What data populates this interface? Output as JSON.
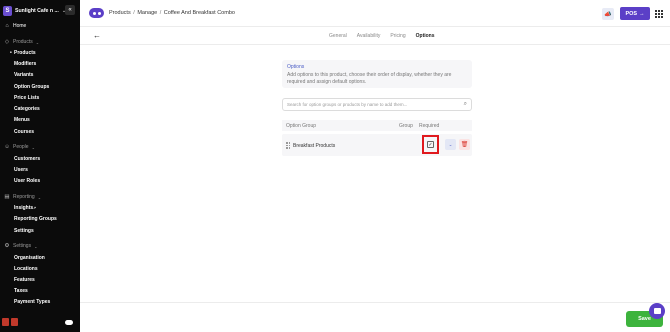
{
  "sidebar": {
    "brand_initial": "S",
    "brand_name": "Sunlight Cafe n ...",
    "collapse_icon": "«",
    "home": "Home",
    "products_section": "Products",
    "products_items": [
      "Products",
      "Modifiers",
      "Variants",
      "Option Groups",
      "Price Lists",
      "Categories",
      "Menus",
      "Courses"
    ],
    "people_section": "People",
    "people_items": [
      "Customers",
      "Users",
      "User Roles"
    ],
    "reporting_section": "Reporting",
    "reporting_items": [
      "Insights",
      "Reporting Groups",
      "Settings"
    ],
    "settings_section": "Settings",
    "settings_items": [
      "Organisation",
      "Locations",
      "Features",
      "Taxes",
      "Payment Types"
    ]
  },
  "topbar": {
    "breadcrumb": [
      "Products",
      "Manage",
      "Coffee And Breakfast Combo"
    ],
    "pos_label": "POS",
    "pos_arrow": "→"
  },
  "tabs": [
    "General",
    "Availability",
    "Pricing",
    "Options"
  ],
  "active_tab": "Options",
  "options": {
    "title": "Options",
    "description": "Add options to this product, choose their order of display, whether they are required and assign default options.",
    "search_placeholder": "Search for option groups or products by name to add them...",
    "columns": {
      "option_group": "Option Group",
      "group": "Group",
      "required": "Required"
    },
    "rows": [
      {
        "name": "Breakfast Products",
        "required": true
      }
    ]
  },
  "footer": {
    "save_label": "Save"
  },
  "colors": {
    "accent": "#5b3fc7",
    "save": "#3db33d",
    "highlight": "#e0191e",
    "delete": "#d9342b"
  }
}
